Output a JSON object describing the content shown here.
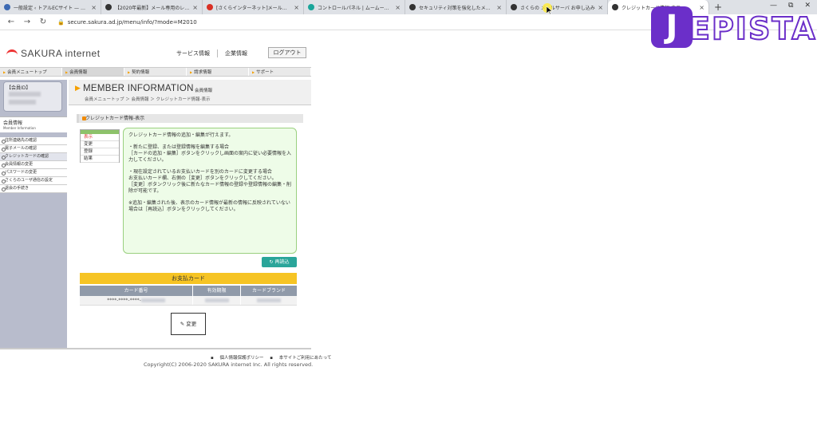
{
  "browser": {
    "tabs": [
      {
        "title": "一般設定 ‹ トアルECサイト — WordPress",
        "color": "#3d6ab3"
      },
      {
        "title": "【2020年最新】メール専用のレンタルサーバー",
        "color": "#333333"
      },
      {
        "title": "[さくらインターネット]メールアドレスの削除",
        "color": "#d93025"
      },
      {
        "title": "コントロールパネル | ムームードメイン",
        "color": "#1aa59a"
      },
      {
        "title": "セキュリティ対策を強化したメールサーバー",
        "color": "#333333"
      },
      {
        "title": "さくらの メールサーバ お申し込み",
        "color": "#333333"
      },
      {
        "title": "クレジットカード情報-表示",
        "color": "#333333"
      }
    ],
    "new_tab": "+",
    "url": "secure.sakura.ad.jp/menu/info/?mode=M2010",
    "window_controls": [
      "—",
      "⧉",
      "✕"
    ]
  },
  "overlay_logo": {
    "badge": "J",
    "text": "EPISTA"
  },
  "site": {
    "brand": "SAKURA internet",
    "header_links": [
      "サービス情報",
      "企業情報"
    ],
    "logout": "ログアウト",
    "gnav": [
      "会員メニュートップ",
      "会員情報",
      "契約情報",
      "請求情報",
      "サポート"
    ],
    "member_id_label": "【会員ID】",
    "side_section_title": "会員情報",
    "side_section_sub": "Member Information",
    "side_items": [
      "住所連絡先の確認",
      "電子メールの確認",
      "クレジットカードの確認",
      "会員情報の変更",
      "パスワードの変更",
      "さくらのユーザ通信の設定",
      "退会の手続き"
    ],
    "page_title": "MEMBER INFORMATION",
    "page_title_jp": "会員情報",
    "breadcrumb": "会員メニュートップ ＞ 会員情報 ＞ クレジットカード情報-表示",
    "section_title": "クレジットカード情報-表示",
    "menu_rows": [
      "表示",
      "変更",
      "登録",
      "結果"
    ],
    "info_paragraphs": [
      "クレジットカード情報の追加・編集が行えます。",
      "・新たに登録、または登録情報を編集する場合\n［カードの追加・編集］ボタンをクリックし画面の案内に従い必要情報を入力してください。",
      "・現在設定されているお支払いカードを別のカードに変更する場合\nお支払いカード欄、右側の［変更］ボタンをクリックしてください。\n［変更］ボタンクリック後に新たなカード情報の登録や登録情報の編集・削除が可能です。",
      "※追加・編集された後、表示のカード情報が最新の情報に反映されていない場合は［再読込］ボタンをクリックしてください。"
    ],
    "reload": "再読込",
    "payment_header": "お支払カード",
    "payment_cols": [
      "カード番号",
      "有効期限",
      "カードブランド"
    ],
    "payment_row": {
      "number": "****-****-****-"
    },
    "change": "変更",
    "footer_links": [
      "個人情報保護ポリシー",
      "本サイトご利用にあたって"
    ],
    "copyright": "Copyright(C) 2006-2020 SAKURA internet Inc. All rights reserved."
  }
}
